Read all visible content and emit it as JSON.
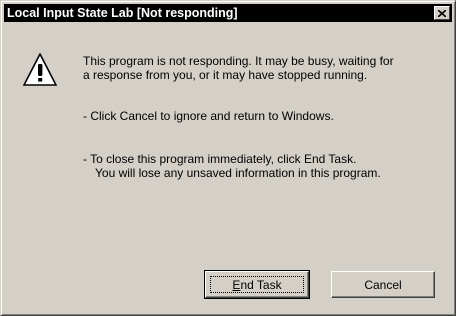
{
  "window": {
    "title": "Local Input State Lab [Not responding]",
    "close_glyph": "×"
  },
  "icon": {
    "name": "warning-icon",
    "glyph": "!"
  },
  "message": {
    "line1": "This program is not responding. It may be busy, waiting for",
    "line2": "a response from you, or it may have stopped running.",
    "bullet1": "-  Click Cancel to ignore and return to Windows.",
    "bullet2_line1": "-  To close this program immediately, click End Task.",
    "bullet2_line2": "You will lose any unsaved information in this program."
  },
  "buttons": {
    "end_task_accel": "E",
    "end_task_rest": "nd Task",
    "cancel": "Cancel"
  },
  "colors": {
    "face": "#d4d0c8",
    "titlebar": "#000000",
    "title_text": "#ffffff"
  }
}
